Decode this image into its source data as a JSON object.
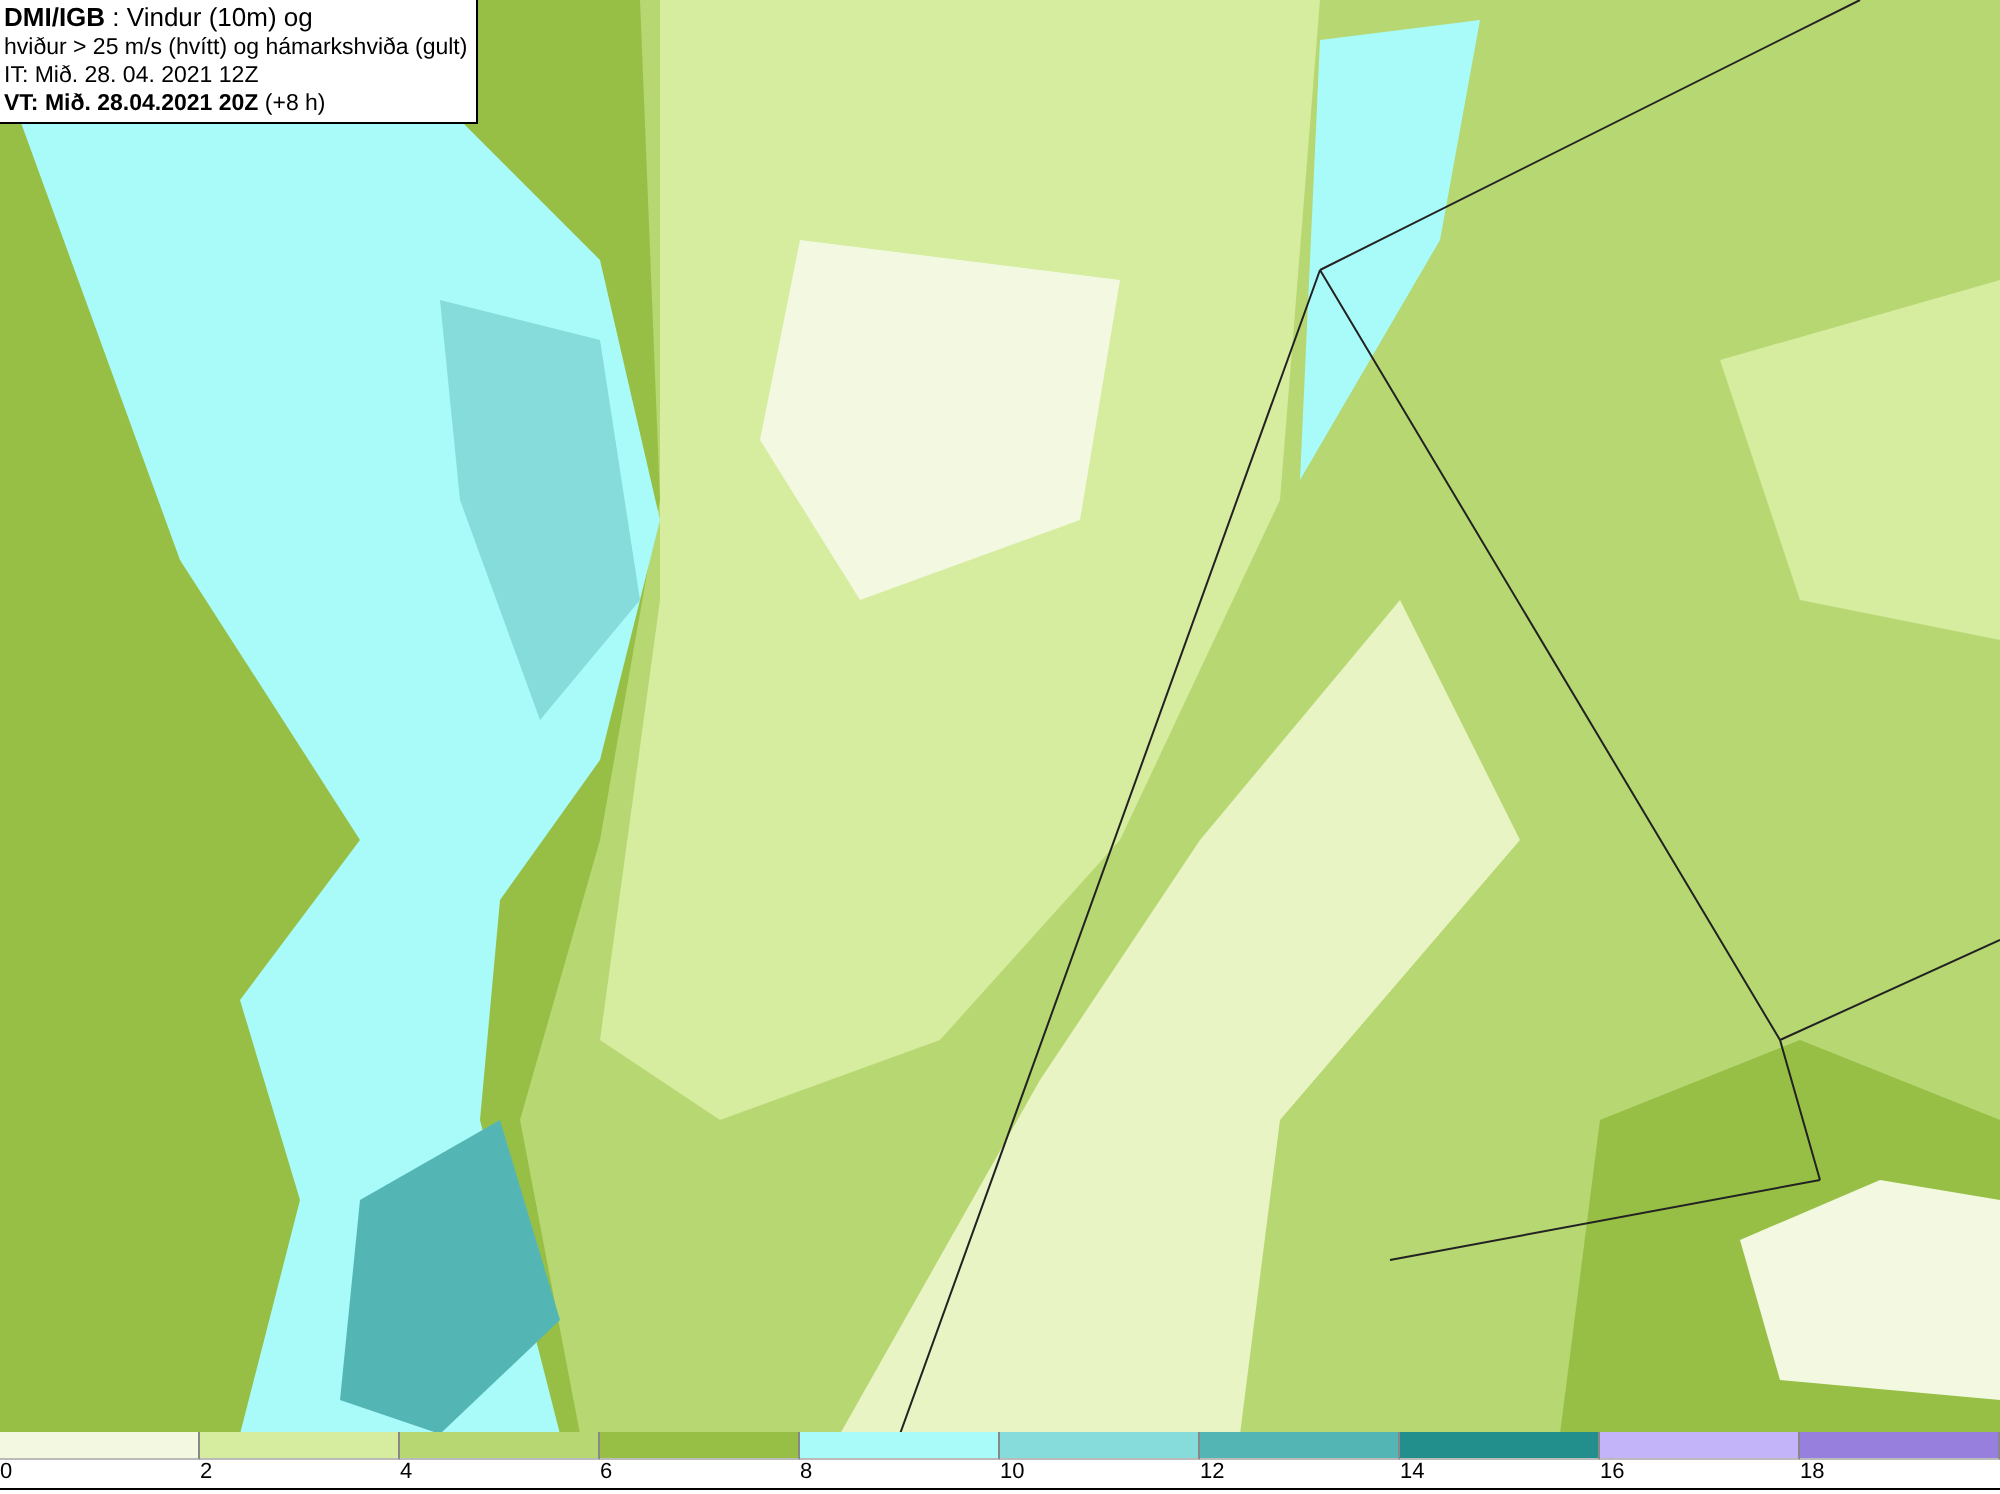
{
  "title_box": {
    "lines": [
      "**DMI/IGB** : Vindur (10m) og",
      "hviður > 25 m/s (hvítt) og hámarkshviða (gult)",
      "IT: Mið. 28. 04. 2021 12Z",
      "**VT: Mið. 28.04.2021 20Z** (+8 h)"
    ]
  },
  "legend": {
    "bins": [
      {
        "color": "#f3f9e1",
        "label": "0"
      },
      {
        "color": "#d6ec9e",
        "label": "2"
      },
      {
        "color": "#b6d771",
        "label": "4"
      },
      {
        "color": "#97bf45",
        "label": "6"
      },
      {
        "color": "#a9fbf9",
        "label": "8"
      },
      {
        "color": "#85dcda",
        "label": "10"
      },
      {
        "color": "#53b6b4",
        "label": "12"
      },
      {
        "color": "#238f8c",
        "label": "14"
      },
      {
        "color": "#c3b4f9",
        "label": "16"
      },
      {
        "color": "#967fdd",
        "label": "18"
      }
    ]
  }
}
